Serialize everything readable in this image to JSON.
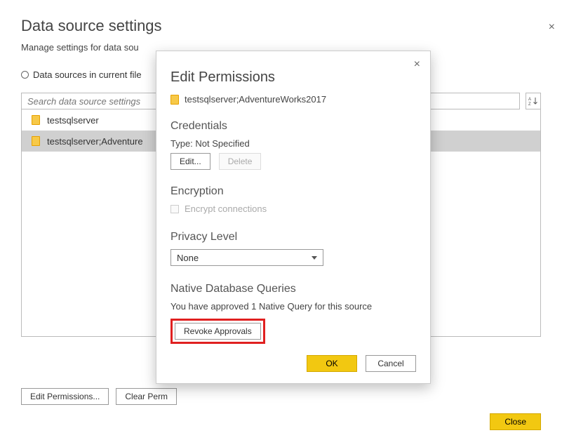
{
  "outer": {
    "title": "Data source settings",
    "subtitle": "Manage settings for data sou",
    "scope_label": "Data sources in current file",
    "search_placeholder": "Search data source settings",
    "sort_label": "A↓Z",
    "edit_permissions_btn": "Edit Permissions...",
    "clear_permissions_btn": "Clear Perm",
    "close_btn": "Close"
  },
  "list": {
    "items": [
      {
        "label": "testsqlserver"
      },
      {
        "label": "testsqlserver;Adventure"
      }
    ]
  },
  "modal": {
    "title": "Edit Permissions",
    "source_name": "testsqlserver;AdventureWorks2017",
    "credentials_heading": "Credentials",
    "cred_type_line": "Type: Not Specified",
    "edit_btn": "Edit...",
    "delete_btn": "Delete",
    "encryption_heading": "Encryption",
    "encrypt_label": "Encrypt connections",
    "privacy_heading": "Privacy Level",
    "privacy_value": "None",
    "ndq_heading": "Native Database Queries",
    "ndq_text": "You have approved 1 Native Query for this source",
    "revoke_btn": "Revoke Approvals",
    "ok_btn": "OK",
    "cancel_btn": "Cancel"
  }
}
